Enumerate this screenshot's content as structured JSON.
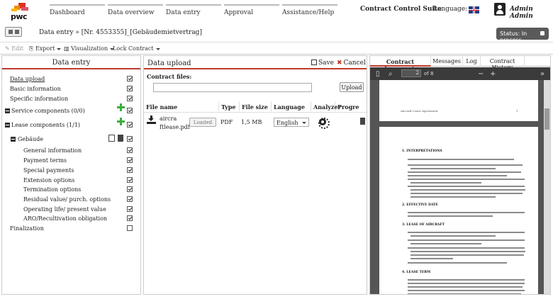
{
  "brand": {
    "logo_text": "pwc"
  },
  "nav": {
    "items": [
      "Dashboard",
      "Data overview",
      "Data entry",
      "Approval",
      "Assistance/Help"
    ]
  },
  "header": {
    "suite_title": "Contract Control Suite",
    "language_label": "Language:",
    "user_name": "Admin Admin",
    "flag_icon": "uk-flag-icon"
  },
  "breadcrumb": {
    "text": "Data entry » [Nr. 4553355]_[Gebäudemietvertrag]"
  },
  "status": {
    "label": "Status: In process"
  },
  "toolbar": {
    "edit": "Edit",
    "export": "Export",
    "visualization": "Visualization",
    "lock_contract": "Lock Contract"
  },
  "left_panel": {
    "title": "Data entry",
    "items": [
      {
        "label": "Data upload",
        "checked": true
      },
      {
        "label": "Basic information",
        "checked": true
      },
      {
        "label": "Specific information",
        "checked": true
      },
      {
        "label": "Service components (0/0)",
        "checked": true
      },
      {
        "label": "Lease components (1/1)",
        "checked": true
      },
      {
        "label": "Gebäude",
        "checked": true
      },
      {
        "label": "General information",
        "checked": true
      },
      {
        "label": "Payment terms",
        "checked": true
      },
      {
        "label": "Special payments",
        "checked": true
      },
      {
        "label": "Extension options",
        "checked": true
      },
      {
        "label": "Termination options",
        "checked": true
      },
      {
        "label": "Residual value/ purch. options",
        "checked": true
      },
      {
        "label": "Operating life/ present value",
        "checked": true
      },
      {
        "label": "ARO/Recultivation obligation",
        "checked": true
      },
      {
        "label": "Finalization",
        "checked": false
      }
    ]
  },
  "upload_panel": {
    "title": "Data upload",
    "save": "Save",
    "cancel": "Cancel",
    "contract_files_label": "Contract files:",
    "upload_button": "Upload",
    "columns": [
      "File name",
      "Type",
      "File size",
      "Language",
      "Analyzer",
      "Progre"
    ],
    "file": {
      "name_line1": "aircra",
      "name_line2": "ftlease.pdf",
      "status": "Loaded",
      "type": "PDF",
      "size": "1,5 MB",
      "language": "English"
    }
  },
  "right_panel": {
    "tabs": [
      "Contract documents",
      "Messages",
      "Log",
      "Contract History"
    ],
    "pdf": {
      "page": "2",
      "of_pages": "of 8",
      "zoom_out": "−",
      "zoom_in": "+"
    },
    "page1_footer_left": "Aircraft Lease Agreement",
    "page1_footer_right": "1",
    "sections": [
      "1.  INTERPRETATIONS",
      "2.  EFFECTIVE DATE",
      "3.  LEASE OF AIRCRAFT",
      "4.  LEASE TERM"
    ]
  }
}
